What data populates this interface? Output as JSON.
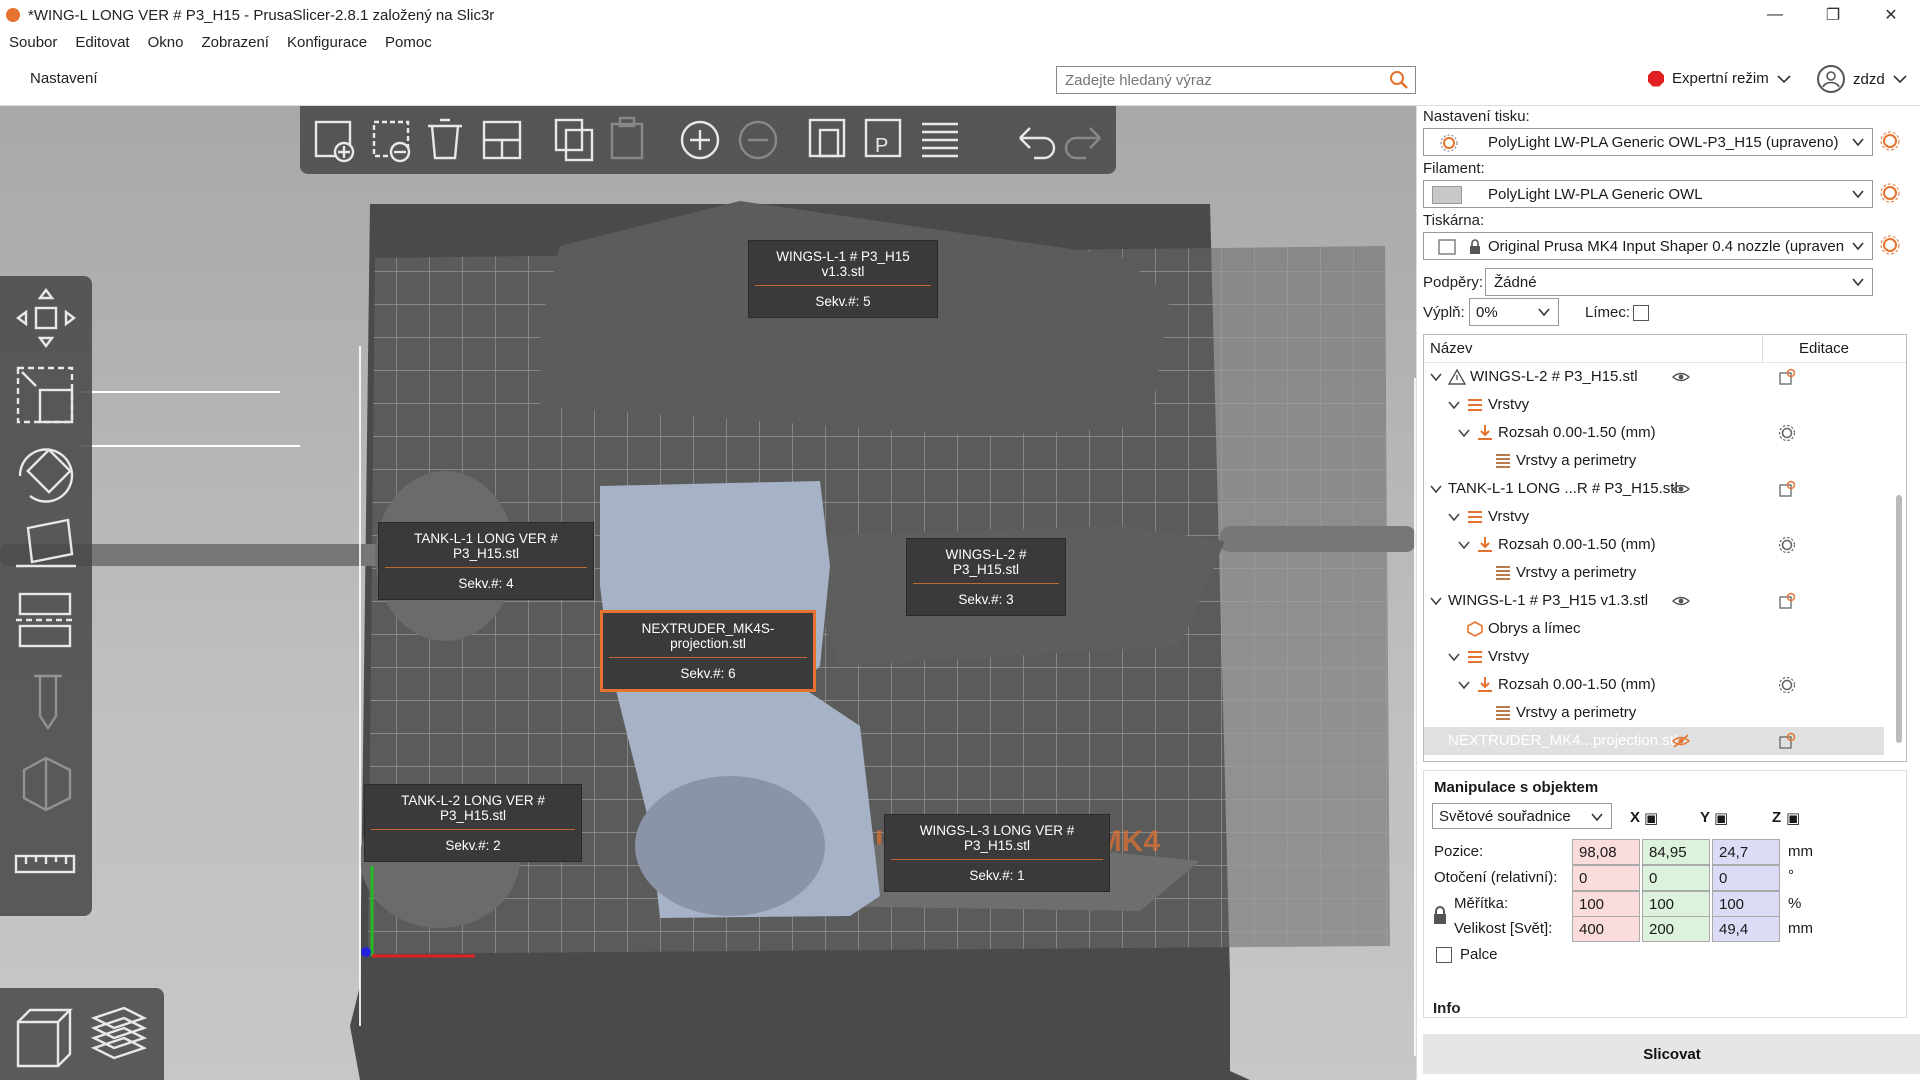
{
  "window": {
    "title": "*WING-L LONG VER # P3_H15 - PrusaSlicer-2.8.1 založený na Slic3r"
  },
  "menu": [
    "Soubor",
    "Editovat",
    "Okno",
    "Zobrazení",
    "Konfigurace",
    "Pomoc"
  ],
  "topbar": {
    "setup_tab": "Nastavení",
    "search_placeholder": "Zadejte hledaný výraz",
    "mode": "Expertní režim",
    "user": "zdzd"
  },
  "viewport": {
    "labels": [
      {
        "name": "WINGS-L-1 # P3_H15 v1.3.stl",
        "seq": "Sekv.#: 5"
      },
      {
        "name": "TANK-L-1 LONG VER # P3_H15.stl",
        "seq": "Sekv.#: 4"
      },
      {
        "name": "WINGS-L-2 # P3_H15.stl",
        "seq": "Sekv.#: 3"
      },
      {
        "name": "NEXTRUDER_MK4S-projection.stl",
        "seq": "Sekv.#: 6"
      },
      {
        "name": "TANK-L-2 LONG VER # P3_H15.stl",
        "seq": "Sekv.#: 2"
      },
      {
        "name": "WINGS-L-3 LONG VER # P3_H15.stl",
        "seq": "Sekv.#: 1"
      }
    ],
    "bed_text": "ORIGINAL PRUSA MK4"
  },
  "panel": {
    "print_label": "Nastavení tisku:",
    "print_value": "PolyLight LW-PLA Generic OWL-P3_H15 (upraveno)",
    "filament_label": "Filament:",
    "filament_value": "PolyLight LW-PLA Generic OWL",
    "printer_label": "Tiskárna:",
    "printer_value": "Original Prusa MK4 Input Shaper 0.4 nozzle (upraven…",
    "supports_label": "Podpěry:",
    "supports_value": "Žádné",
    "infill_label": "Výplň:",
    "infill_value": "0%",
    "brim_label": "Límec:",
    "list_header_name": "Název",
    "list_header_edit": "Editace",
    "rows": [
      {
        "text": "WINGS-L-2 # P3_H15.stl"
      },
      {
        "text": "Vrstvy"
      },
      {
        "text": "Rozsah 0.00-1.50 (mm)"
      },
      {
        "text": "Vrstvy a perimetry"
      },
      {
        "text": "TANK-L-1 LONG ...R # P3_H15.stl"
      },
      {
        "text": "Vrstvy"
      },
      {
        "text": "Rozsah 0.00-1.50 (mm)"
      },
      {
        "text": "Vrstvy a perimetry"
      },
      {
        "text": "WINGS-L-1 # P3_H15 v1.3.stl"
      },
      {
        "text": "Obrys a límec"
      },
      {
        "text": "Vrstvy"
      },
      {
        "text": "Rozsah 0.00-1.50 (mm)"
      },
      {
        "text": "Vrstvy a perimetry"
      },
      {
        "text": "NEXTRUDER_MK4...projection.stl"
      }
    ],
    "manip": {
      "title": "Manipulace s objektem",
      "coords": "Světové souřadnice",
      "x": "X",
      "y": "Y",
      "z": "Z",
      "pos_label": "Pozice:",
      "rot_label": "Otočení (relativní):",
      "scale_label": "Měřítka:",
      "size_label": "Velikost [Svět]:",
      "inch_label": "Palce",
      "pos": [
        "98,08",
        "84,95",
        "24,7"
      ],
      "rot": [
        "0",
        "0",
        "0"
      ],
      "scale": [
        "100",
        "100",
        "100"
      ],
      "size": [
        "400",
        "200",
        "49,4"
      ],
      "unit_mm": "mm",
      "unit_deg": "°",
      "unit_pct": "%"
    },
    "info_label": "Info",
    "slice_button": "Slicovat"
  },
  "colors": {
    "accent": "#e5732f",
    "model": "#a6b2c6",
    "part": "#555555"
  }
}
